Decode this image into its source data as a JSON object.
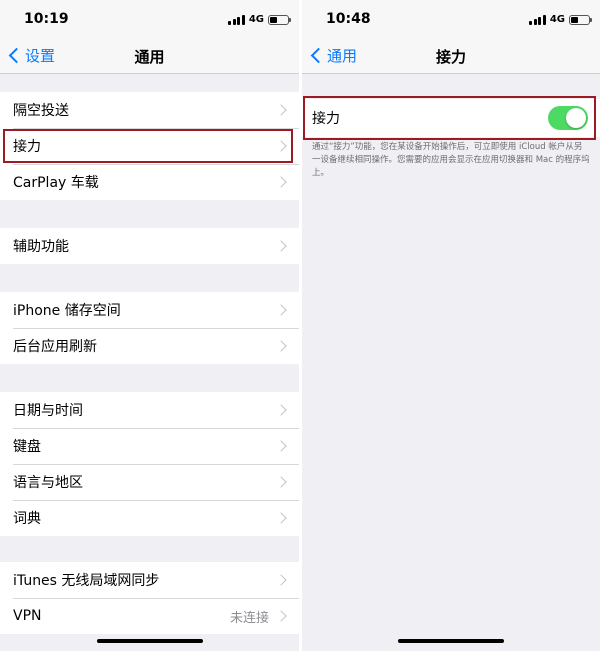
{
  "left": {
    "status": {
      "time": "10:19",
      "network": "4G"
    },
    "nav": {
      "back_label": "设置",
      "title": "通用"
    },
    "groups": [
      {
        "items": [
          {
            "label": "隔空投送"
          },
          {
            "label": "接力"
          },
          {
            "label": "CarPlay 车载"
          }
        ]
      },
      {
        "items": [
          {
            "label": "辅助功能"
          }
        ]
      },
      {
        "items": [
          {
            "label": "iPhone 储存空间"
          },
          {
            "label": "后台应用刷新"
          }
        ]
      },
      {
        "items": [
          {
            "label": "日期与时间"
          },
          {
            "label": "键盘"
          },
          {
            "label": "语言与地区"
          },
          {
            "label": "词典"
          }
        ]
      },
      {
        "items": [
          {
            "label": "iTunes 无线局域网同步"
          },
          {
            "label": "VPN",
            "value": "未连接"
          }
        ]
      }
    ]
  },
  "right": {
    "status": {
      "time": "10:48",
      "network": "4G"
    },
    "nav": {
      "back_label": "通用",
      "title": "接力"
    },
    "handoff": {
      "label": "接力",
      "enabled": true,
      "footnote": "通过“接力”功能，您在某设备开始操作后，可立即使用 iCloud 帐户从另一设备继续相同操作。您需要的应用会显示在应用切换器和 Mac 的程序坞上。"
    }
  },
  "colors": {
    "accent": "#0a7aff",
    "toggle_on": "#4cd964",
    "highlight": "#9b1b23",
    "background": "#efeff4"
  }
}
